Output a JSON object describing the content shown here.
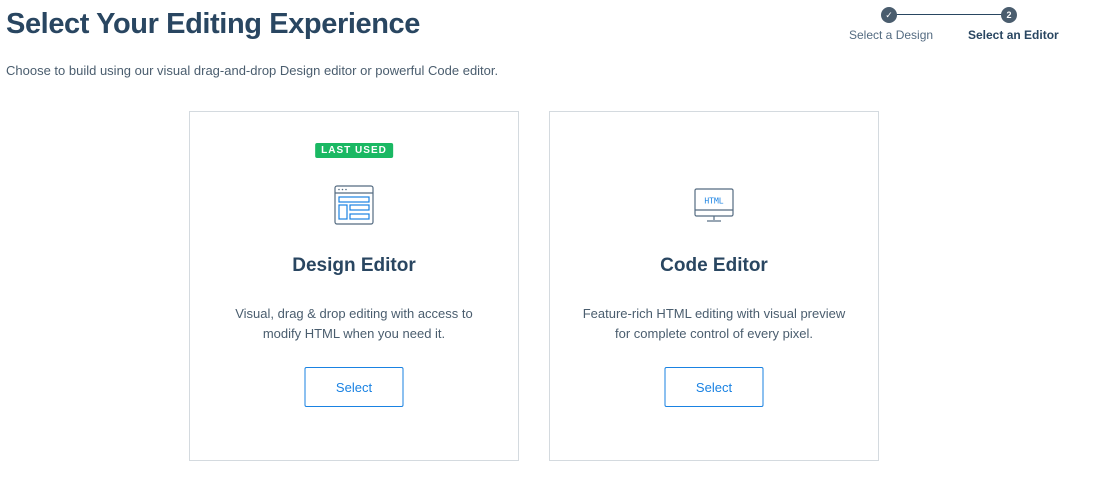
{
  "header": {
    "title": "Select Your Editing Experience",
    "subtitle": "Choose to build using our visual drag-and-drop Design editor or powerful Code editor."
  },
  "stepper": {
    "steps": [
      {
        "label": "Select a Design",
        "marker": "✓",
        "state": "completed"
      },
      {
        "label": "Select an Editor",
        "marker": "2",
        "state": "current"
      }
    ]
  },
  "cards": [
    {
      "badge": "LAST USED",
      "icon": "design-editor-layout-icon",
      "title": "Design Editor",
      "description": "Visual, drag & drop editing with access to modify HTML when you need it.",
      "button_label": "Select"
    },
    {
      "icon": "html-monitor-icon",
      "icon_text": "HTML",
      "title": "Code Editor",
      "description": "Feature-rich HTML editing with visual preview for complete control of every pixel.",
      "button_label": "Select"
    }
  ],
  "colors": {
    "title": "#294661",
    "accent": "#1a82e2",
    "badge": "#1ab863",
    "border": "#d4dadf",
    "icon_stroke": "#546b81",
    "icon_accent": "#1a82e2"
  }
}
